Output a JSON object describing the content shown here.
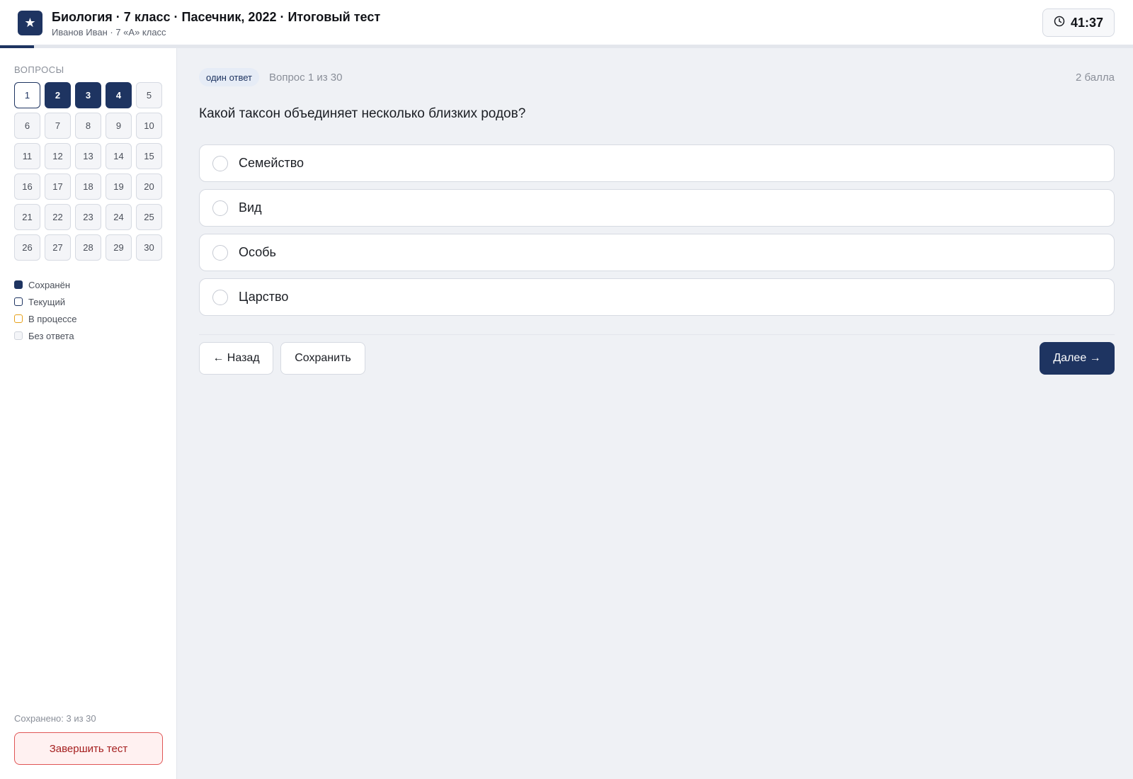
{
  "header": {
    "logo_glyph": "★",
    "title": "Биология · 7 класс · Пасечник, 2022 · Итоговый тест",
    "subtitle": "Иванов Иван · 7 «А» класс",
    "timer": "41:37",
    "timer_icon": "clock-icon",
    "progress_fraction": 0.03
  },
  "sidebar": {
    "heading": "ВОПРОСЫ",
    "questions": [
      {
        "n": "1",
        "state": "current"
      },
      {
        "n": "2",
        "state": "saved"
      },
      {
        "n": "3",
        "state": "saved"
      },
      {
        "n": "4",
        "state": "saved"
      },
      {
        "n": "5",
        "state": "none"
      },
      {
        "n": "6",
        "state": "none"
      },
      {
        "n": "7",
        "state": "none"
      },
      {
        "n": "8",
        "state": "none"
      },
      {
        "n": "9",
        "state": "none"
      },
      {
        "n": "10",
        "state": "none"
      },
      {
        "n": "11",
        "state": "none"
      },
      {
        "n": "12",
        "state": "none"
      },
      {
        "n": "13",
        "state": "none"
      },
      {
        "n": "14",
        "state": "none"
      },
      {
        "n": "15",
        "state": "none"
      },
      {
        "n": "16",
        "state": "none"
      },
      {
        "n": "17",
        "state": "none"
      },
      {
        "n": "18",
        "state": "none"
      },
      {
        "n": "19",
        "state": "none"
      },
      {
        "n": "20",
        "state": "none"
      },
      {
        "n": "21",
        "state": "none"
      },
      {
        "n": "22",
        "state": "none"
      },
      {
        "n": "23",
        "state": "none"
      },
      {
        "n": "24",
        "state": "none"
      },
      {
        "n": "25",
        "state": "none"
      },
      {
        "n": "26",
        "state": "none"
      },
      {
        "n": "27",
        "state": "none"
      },
      {
        "n": "28",
        "state": "none"
      },
      {
        "n": "29",
        "state": "none"
      },
      {
        "n": "30",
        "state": "none"
      }
    ],
    "legend": {
      "saved": "Сохранён",
      "current": "Текущий",
      "in_progress": "В процессе",
      "no_answer": "Без ответа"
    },
    "saved_count": "Сохранено: 3 из 30",
    "finish_label": "Завершить тест"
  },
  "main": {
    "badge": "один ответ",
    "counter": "Вопрос 1 из 30",
    "points": "2 балла",
    "question": "Какой таксон объединяет несколько близких родов?",
    "options": [
      "Семейство",
      "Вид",
      "Особь",
      "Царство"
    ],
    "back_label": "← Назад",
    "save_label": "Сохранить",
    "next_label": "Далее →"
  },
  "colors": {
    "accent": "#1e3461",
    "in_progress": "#e6a019",
    "danger": "#e05555",
    "background": "#eff1f5"
  }
}
